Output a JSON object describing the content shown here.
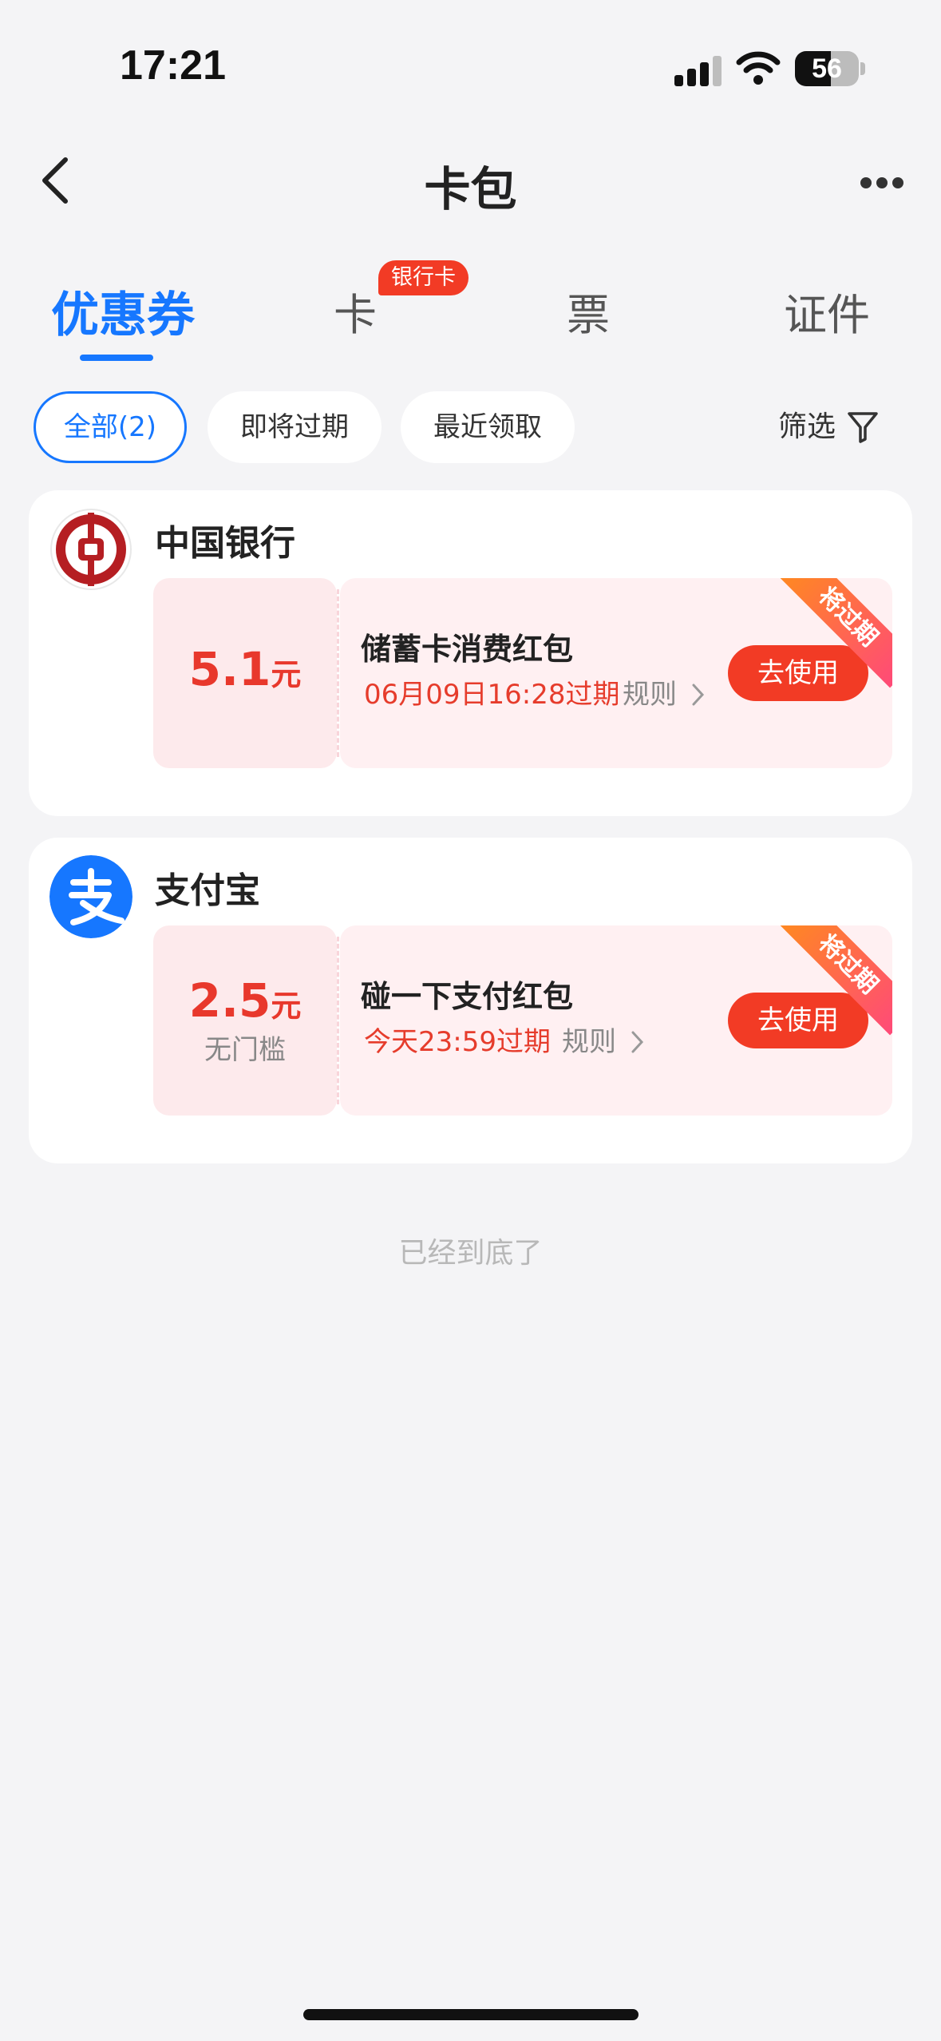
{
  "status_bar": {
    "time": "17:21",
    "battery": "56",
    "battery_level": 0.56
  },
  "nav": {
    "title": "卡包"
  },
  "tabs": [
    {
      "label": "优惠券",
      "active": true
    },
    {
      "label": "卡",
      "badge": "银行卡"
    },
    {
      "label": "票"
    },
    {
      "label": "证件"
    }
  ],
  "filters": {
    "chips": [
      "全部(2)",
      "即将过期",
      "最近领取"
    ],
    "filter_label": "筛选"
  },
  "cards": [
    {
      "issuer": "中国银行",
      "amount": "5.1",
      "unit": "元",
      "threshold": "",
      "title": "储蓄卡消费红包",
      "expire": "06月09日16:28过期",
      "rules": "规则",
      "action": "去使用",
      "ribbon": "将过期"
    },
    {
      "issuer": "支付宝",
      "amount": "2.5",
      "unit": "元",
      "threshold": "无门槛",
      "title": "碰一下支付红包",
      "expire": "今天23:59过期",
      "rules": "规则",
      "action": "去使用",
      "ribbon": "将过期"
    }
  ],
  "footer": {
    "end_text": "已经到底了"
  },
  "colors": {
    "accent": "#1677ff",
    "red": "#f23b25",
    "boc_red": "#b51e22",
    "alipay_blue": "#1677ff"
  },
  "icons": [
    "back-chevron-icon",
    "more-dots-icon",
    "filter-funnel-icon",
    "boc-logo-icon",
    "alipay-logo-icon",
    "chevron-right-icon"
  ]
}
